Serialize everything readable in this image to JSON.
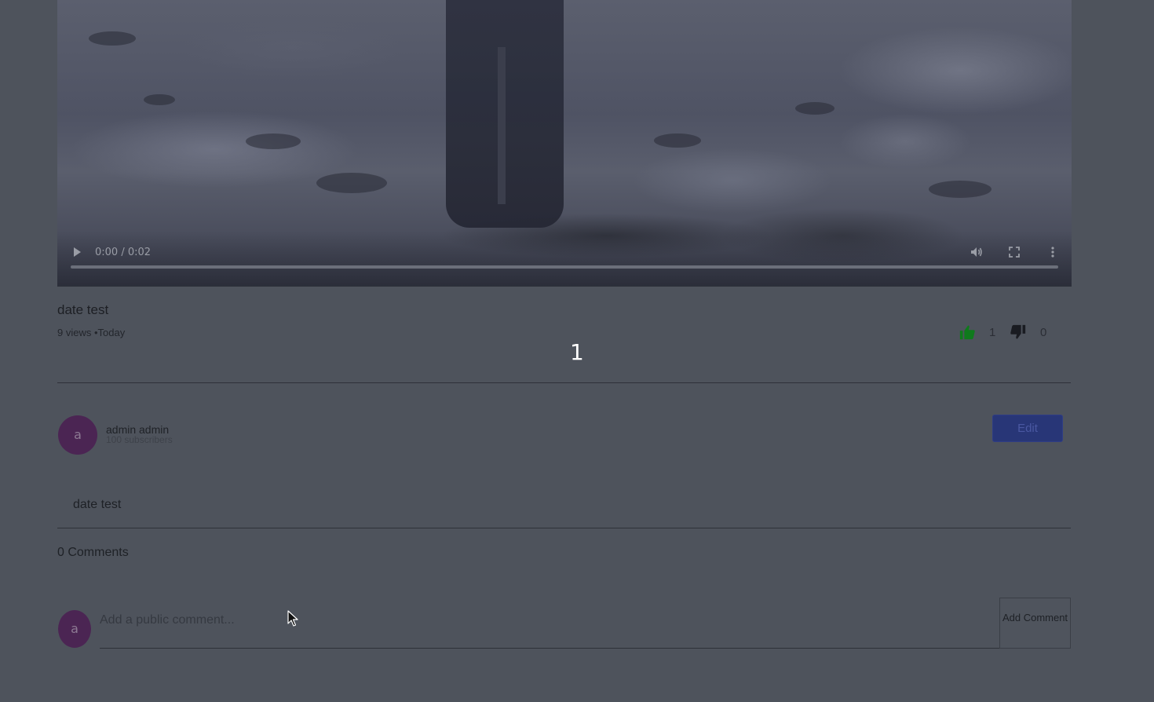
{
  "video": {
    "time": "0:00 / 0:02",
    "progress": 0,
    "controls": {
      "play_icon": "play-icon",
      "volume_icon": "volume-icon",
      "fullscreen_icon": "fullscreen-icon",
      "more_icon": "more-vert-icon"
    }
  },
  "meta": {
    "title": "date test",
    "stats": "9 views •Today",
    "center_number": "1"
  },
  "reactions": {
    "likes": "1",
    "dislikes": "0",
    "like_color": "#0f7a1c",
    "dislike_color": "#1a1c22"
  },
  "channel": {
    "avatar_letter": "a",
    "name": "admin admin",
    "subscribers": "100 subscribers",
    "edit_label": "Edit",
    "avatar_color": "#4b2553"
  },
  "description": "date test",
  "comments": {
    "count_label": "0 Comments",
    "avatar_letter": "a",
    "placeholder": "Add a public comment...",
    "value": "",
    "add_label": "Add Comment"
  },
  "theme": {
    "overlay_background": "#4e535c",
    "edit_button_color": "#283677"
  }
}
